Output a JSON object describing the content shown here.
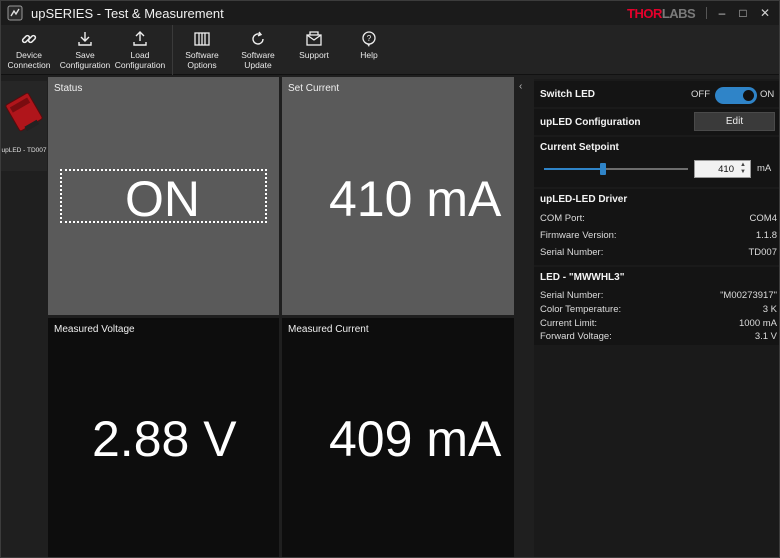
{
  "window": {
    "title": "upSERIES - Test & Measurement",
    "brand_part1": "THOR",
    "brand_part2": "LABS",
    "minimize": "–",
    "maximize": "□",
    "close": "✕"
  },
  "toolbar": {
    "buttons": [
      {
        "label1": "Device",
        "label2": "Connection",
        "icon": "link-icon"
      },
      {
        "label1": "Save",
        "label2": "Configuration",
        "icon": "download-icon"
      },
      {
        "label1": "Load",
        "label2": "Configuration",
        "icon": "upload-icon"
      },
      {
        "label1": "Software",
        "label2": "Options",
        "icon": "options-icon"
      },
      {
        "label1": "Software",
        "label2": "Update",
        "icon": "update-icon"
      },
      {
        "label1": "Support",
        "label2": "",
        "icon": "envelope-icon"
      },
      {
        "label1": "Help",
        "label2": "",
        "icon": "help-icon"
      }
    ]
  },
  "device": {
    "label": "upLED - TD007"
  },
  "tiles": {
    "status": {
      "label": "Status",
      "value": "ON"
    },
    "set_current": {
      "label": "Set Current",
      "value": "410 mA"
    },
    "measured_voltage": {
      "label": "Measured Voltage",
      "value": "2.88 V"
    },
    "measured_current": {
      "label": "Measured Current",
      "value": "409 mA"
    }
  },
  "panel": {
    "collapse": "‹",
    "switch_led": {
      "title": "Switch LED",
      "off": "OFF",
      "on": "ON",
      "state": true
    },
    "config": {
      "title": "upLED Configuration",
      "button": "Edit"
    },
    "setpoint": {
      "title": "Current Setpoint",
      "value": "410",
      "unit": "mA",
      "slider_fraction": 0.41
    },
    "driver": {
      "title": "upLED-LED Driver",
      "rows": [
        {
          "k": "COM Port:",
          "v": "COM4"
        },
        {
          "k": "Firmware Version:",
          "v": "1.1.8"
        },
        {
          "k": "Serial Number:",
          "v": "TD007"
        }
      ]
    },
    "led": {
      "title": "LED - \"MWWHL3\"",
      "rows": [
        {
          "k": "Serial Number:",
          "v": "\"M00273917\""
        },
        {
          "k": "Color Temperature:",
          "v": "3 K"
        },
        {
          "k": "Current Limit:",
          "v": "1000 mA"
        },
        {
          "k": "Forward Voltage:",
          "v": "3.1 V"
        }
      ]
    }
  },
  "colors": {
    "accent": "#2f84c8",
    "brand_red": "#e4002b"
  }
}
